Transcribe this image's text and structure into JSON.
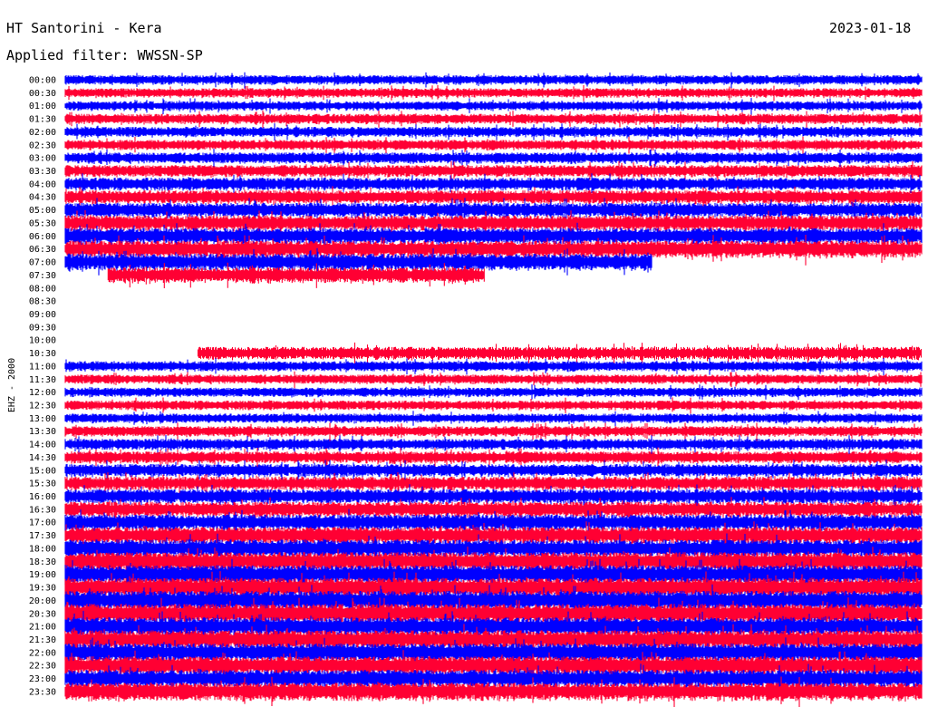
{
  "header": {
    "title": "HT Santorini - Kera",
    "date": "2023-01-18",
    "filter": "Applied filter: WWSSN-SP"
  },
  "chart_data": {
    "type": "line",
    "title": "HT Santorini - Kera",
    "subtitle": "Applied filter: WWSSN-SP",
    "date": "2023-01-18",
    "ylabel": "EHZ - 2000",
    "tick_labels": [
      "00:00",
      "00:30",
      "01:00",
      "01:30",
      "02:00",
      "02:30",
      "03:00",
      "03:30",
      "04:00",
      "04:30",
      "05:00",
      "05:30",
      "06:00",
      "06:30",
      "07:00",
      "07:30",
      "08:00",
      "08:30",
      "09:00",
      "09:30",
      "10:00",
      "10:30",
      "11:00",
      "11:30",
      "12:00",
      "12:30",
      "13:00",
      "13:30",
      "14:00",
      "14:30",
      "15:00",
      "15:30",
      "16:00",
      "16:30",
      "17:00",
      "17:30",
      "18:00",
      "18:30",
      "19:00",
      "19:30",
      "20:00",
      "20:30",
      "21:00",
      "21:30",
      "22:00",
      "22:30",
      "23:00",
      "23:30"
    ],
    "trace_colors": [
      "#0000ff",
      "#ff0033"
    ],
    "traces": [
      {
        "label": "00:00",
        "start": 0.0,
        "end": 1.0,
        "amp": 0.55
      },
      {
        "label": "00:30",
        "start": 0.0,
        "end": 1.0,
        "amp": 0.55
      },
      {
        "label": "01:00",
        "start": 0.0,
        "end": 1.0,
        "amp": 0.55
      },
      {
        "label": "01:30",
        "start": 0.0,
        "end": 1.0,
        "amp": 0.6
      },
      {
        "label": "02:00",
        "start": 0.0,
        "end": 1.0,
        "amp": 0.6
      },
      {
        "label": "02:30",
        "start": 0.0,
        "end": 1.0,
        "amp": 0.6
      },
      {
        "label": "03:00",
        "start": 0.0,
        "end": 1.0,
        "amp": 0.65
      },
      {
        "label": "03:30",
        "start": 0.0,
        "end": 1.0,
        "amp": 0.7
      },
      {
        "label": "04:00",
        "start": 0.0,
        "end": 1.0,
        "amp": 0.75
      },
      {
        "label": "04:30",
        "start": 0.0,
        "end": 1.0,
        "amp": 0.8
      },
      {
        "label": "05:00",
        "start": 0.0,
        "end": 1.0,
        "amp": 0.85
      },
      {
        "label": "05:30",
        "start": 0.0,
        "end": 1.0,
        "amp": 0.9
      },
      {
        "label": "06:00",
        "start": 0.0,
        "end": 1.0,
        "amp": 0.95
      },
      {
        "label": "06:30",
        "start": 0.0,
        "end": 1.0,
        "amp": 1.0
      },
      {
        "label": "07:00",
        "start": 0.0,
        "end": 0.685,
        "amp": 1.0
      },
      {
        "label": "07:30",
        "start": 0.05,
        "end": 0.49,
        "amp": 0.9
      },
      {
        "label": "10:30",
        "start": 0.155,
        "end": 1.0,
        "amp": 0.75
      },
      {
        "label": "11:00",
        "start": 0.0,
        "end": 1.0,
        "amp": 0.6
      },
      {
        "label": "11:30",
        "start": 0.0,
        "end": 1.0,
        "amp": 0.55
      },
      {
        "label": "12:00",
        "start": 0.0,
        "end": 1.0,
        "amp": 0.55
      },
      {
        "label": "12:30",
        "start": 0.0,
        "end": 1.0,
        "amp": 0.55
      },
      {
        "label": "13:00",
        "start": 0.0,
        "end": 1.0,
        "amp": 0.55
      },
      {
        "label": "13:30",
        "start": 0.0,
        "end": 1.0,
        "amp": 0.6
      },
      {
        "label": "14:00",
        "start": 0.0,
        "end": 1.0,
        "amp": 0.65
      },
      {
        "label": "14:30",
        "start": 0.0,
        "end": 1.0,
        "amp": 0.7
      },
      {
        "label": "15:00",
        "start": 0.0,
        "end": 1.0,
        "amp": 0.75
      },
      {
        "label": "15:30",
        "start": 0.0,
        "end": 1.0,
        "amp": 0.8
      },
      {
        "label": "16:00",
        "start": 0.0,
        "end": 1.0,
        "amp": 0.85
      },
      {
        "label": "16:30",
        "start": 0.0,
        "end": 1.0,
        "amp": 0.9
      },
      {
        "label": "17:00",
        "start": 0.0,
        "end": 1.0,
        "amp": 0.95
      },
      {
        "label": "17:30",
        "start": 0.0,
        "end": 1.0,
        "amp": 1.0
      },
      {
        "label": "18:00",
        "start": 0.0,
        "end": 1.0,
        "amp": 1.05
      },
      {
        "label": "18:30",
        "start": 0.0,
        "end": 1.0,
        "amp": 1.1
      },
      {
        "label": "19:00",
        "start": 0.0,
        "end": 1.0,
        "amp": 1.1
      },
      {
        "label": "19:30",
        "start": 0.0,
        "end": 1.0,
        "amp": 1.15
      },
      {
        "label": "20:00",
        "start": 0.0,
        "end": 1.0,
        "amp": 1.15
      },
      {
        "label": "20:30",
        "start": 0.0,
        "end": 1.0,
        "amp": 1.15
      },
      {
        "label": "21:00",
        "start": 0.0,
        "end": 1.0,
        "amp": 1.1
      },
      {
        "label": "21:30",
        "start": 0.0,
        "end": 1.0,
        "amp": 1.1
      },
      {
        "label": "22:00",
        "start": 0.0,
        "end": 1.0,
        "amp": 1.1
      },
      {
        "label": "22:30",
        "start": 0.0,
        "end": 1.0,
        "amp": 1.1
      },
      {
        "label": "23:00",
        "start": 0.0,
        "end": 1.0,
        "amp": 1.05
      },
      {
        "label": "23:30",
        "start": 0.0,
        "end": 1.0,
        "amp": 1.05
      }
    ]
  }
}
